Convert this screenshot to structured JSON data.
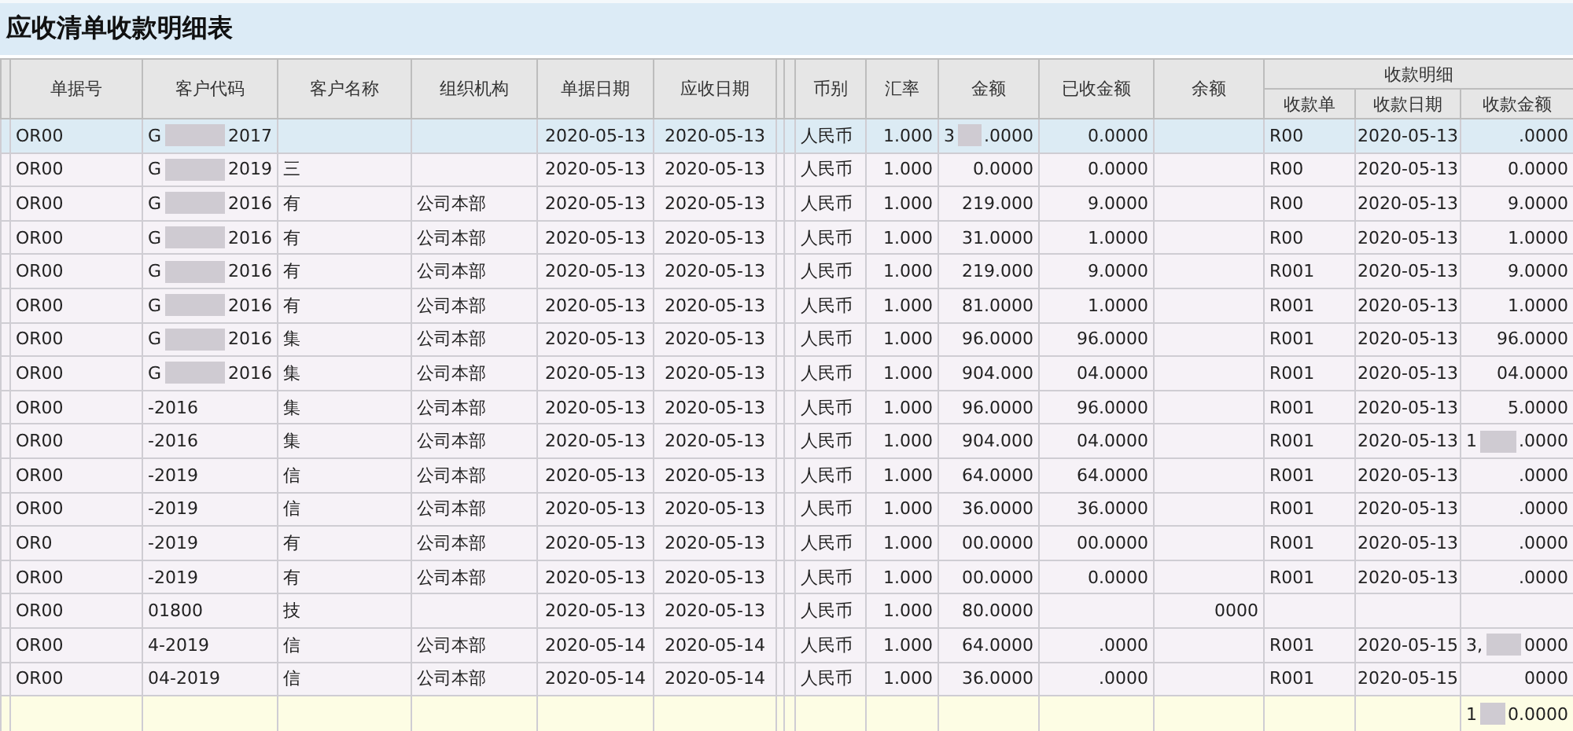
{
  "title": "应收清单收款明细表",
  "table": {
    "columns": [
      "单据号",
      "客户代码",
      "客户名称",
      "组织机构",
      "单据日期",
      "应收日期",
      "币别",
      "汇率",
      "金额",
      "已收金额",
      "余额"
    ],
    "group": {
      "label": "收款明细",
      "columns": [
        "收款单",
        "收款日期",
        "收款金额"
      ]
    },
    "rows": [
      {
        "selected": true,
        "cells": [
          [
            "OR00"
          ],
          [
            "G",
            "2017"
          ],
          [],
          [],
          [
            "2020-05-13"
          ],
          [
            "2020-05-13"
          ],
          [
            "人民币"
          ],
          [
            "1.000"
          ],
          [
            "3",
            ".0000"
          ],
          [
            "0.0000"
          ],
          [],
          [
            "R00"
          ],
          [
            "2020-05-13"
          ],
          [
            ".0000"
          ]
        ]
      },
      {
        "selected": false,
        "cells": [
          [
            "OR00"
          ],
          [
            "G",
            "2019"
          ],
          [
            "三"
          ],
          [],
          [
            "2020-05-13"
          ],
          [
            "2020-05-13"
          ],
          [
            "人民币"
          ],
          [
            "1.000"
          ],
          [
            "0.0000"
          ],
          [
            "0.0000"
          ],
          [],
          [
            "R00"
          ],
          [
            "2020-05-13"
          ],
          [
            "0.0000"
          ]
        ]
      },
      {
        "selected": false,
        "cells": [
          [
            "OR00"
          ],
          [
            "G",
            "2016"
          ],
          [
            "有"
          ],
          [
            "公司本部"
          ],
          [
            "2020-05-13"
          ],
          [
            "2020-05-13"
          ],
          [
            "人民币"
          ],
          [
            "1.000"
          ],
          [
            "219.000"
          ],
          [
            "9.0000"
          ],
          [],
          [
            "R00"
          ],
          [
            "2020-05-13"
          ],
          [
            "9.0000"
          ]
        ]
      },
      {
        "selected": false,
        "cells": [
          [
            "OR00"
          ],
          [
            "G",
            "2016"
          ],
          [
            "有"
          ],
          [
            "公司本部"
          ],
          [
            "2020-05-13"
          ],
          [
            "2020-05-13"
          ],
          [
            "人民币"
          ],
          [
            "1.000"
          ],
          [
            "31.0000"
          ],
          [
            "1.0000"
          ],
          [],
          [
            "R00"
          ],
          [
            "2020-05-13"
          ],
          [
            "1.0000"
          ]
        ]
      },
      {
        "selected": false,
        "cells": [
          [
            "OR00"
          ],
          [
            "G",
            "2016"
          ],
          [
            "有"
          ],
          [
            "公司本部"
          ],
          [
            "2020-05-13"
          ],
          [
            "2020-05-13"
          ],
          [
            "人民币"
          ],
          [
            "1.000"
          ],
          [
            "219.000"
          ],
          [
            "9.0000"
          ],
          [],
          [
            "R001"
          ],
          [
            "2020-05-13"
          ],
          [
            "9.0000"
          ]
        ]
      },
      {
        "selected": false,
        "cells": [
          [
            "OR00"
          ],
          [
            "G",
            "2016"
          ],
          [
            "有"
          ],
          [
            "公司本部"
          ],
          [
            "2020-05-13"
          ],
          [
            "2020-05-13"
          ],
          [
            "人民币"
          ],
          [
            "1.000"
          ],
          [
            "81.0000"
          ],
          [
            "1.0000"
          ],
          [],
          [
            "R001"
          ],
          [
            "2020-05-13"
          ],
          [
            "1.0000"
          ]
        ]
      },
      {
        "selected": false,
        "cells": [
          [
            "OR00"
          ],
          [
            "G",
            "2016"
          ],
          [
            "集"
          ],
          [
            "公司本部"
          ],
          [
            "2020-05-13"
          ],
          [
            "2020-05-13"
          ],
          [
            "人民币"
          ],
          [
            "1.000"
          ],
          [
            "96.0000"
          ],
          [
            "96.0000"
          ],
          [],
          [
            "R001"
          ],
          [
            "2020-05-13"
          ],
          [
            "96.0000"
          ]
        ]
      },
      {
        "selected": false,
        "cells": [
          [
            "OR00"
          ],
          [
            "G",
            "2016"
          ],
          [
            "集"
          ],
          [
            "公司本部"
          ],
          [
            "2020-05-13"
          ],
          [
            "2020-05-13"
          ],
          [
            "人民币"
          ],
          [
            "1.000"
          ],
          [
            "904.000"
          ],
          [
            "04.0000"
          ],
          [],
          [
            "R001"
          ],
          [
            "2020-05-13"
          ],
          [
            "04.0000"
          ]
        ]
      },
      {
        "selected": false,
        "cells": [
          [
            "OR00"
          ],
          [
            "-2016"
          ],
          [
            "集"
          ],
          [
            "公司本部"
          ],
          [
            "2020-05-13"
          ],
          [
            "2020-05-13"
          ],
          [
            "人民币"
          ],
          [
            "1.000"
          ],
          [
            "96.0000"
          ],
          [
            "96.0000"
          ],
          [],
          [
            "R001"
          ],
          [
            "2020-05-13"
          ],
          [
            "5.0000"
          ]
        ]
      },
      {
        "selected": false,
        "cells": [
          [
            "OR00"
          ],
          [
            "-2016"
          ],
          [
            "集"
          ],
          [
            "公司本部"
          ],
          [
            "2020-05-13"
          ],
          [
            "2020-05-13"
          ],
          [
            "人民币"
          ],
          [
            "1.000"
          ],
          [
            "904.000"
          ],
          [
            "04.0000"
          ],
          [],
          [
            "R001"
          ],
          [
            "2020-05-13"
          ],
          [
            "1",
            ".0000"
          ]
        ]
      },
      {
        "selected": false,
        "cells": [
          [
            "OR00"
          ],
          [
            "-2019"
          ],
          [
            "信"
          ],
          [
            "公司本部"
          ],
          [
            "2020-05-13"
          ],
          [
            "2020-05-13"
          ],
          [
            "人民币"
          ],
          [
            "1.000"
          ],
          [
            "64.0000"
          ],
          [
            "64.0000"
          ],
          [],
          [
            "R001"
          ],
          [
            "2020-05-13"
          ],
          [
            ".0000"
          ]
        ]
      },
      {
        "selected": false,
        "cells": [
          [
            "OR00"
          ],
          [
            "-2019"
          ],
          [
            "信"
          ],
          [
            "公司本部"
          ],
          [
            "2020-05-13"
          ],
          [
            "2020-05-13"
          ],
          [
            "人民币"
          ],
          [
            "1.000"
          ],
          [
            "36.0000"
          ],
          [
            "36.0000"
          ],
          [],
          [
            "R001"
          ],
          [
            "2020-05-13"
          ],
          [
            ".0000"
          ]
        ]
      },
      {
        "selected": false,
        "cells": [
          [
            "OR0"
          ],
          [
            "-2019"
          ],
          [
            "有"
          ],
          [
            "公司本部"
          ],
          [
            "2020-05-13"
          ],
          [
            "2020-05-13"
          ],
          [
            "人民币"
          ],
          [
            "1.000"
          ],
          [
            "00.0000"
          ],
          [
            "00.0000"
          ],
          [],
          [
            "R001"
          ],
          [
            "2020-05-13"
          ],
          [
            ".0000"
          ]
        ]
      },
      {
        "selected": false,
        "cells": [
          [
            "OR00"
          ],
          [
            "-2019"
          ],
          [
            "有"
          ],
          [
            "公司本部"
          ],
          [
            "2020-05-13"
          ],
          [
            "2020-05-13"
          ],
          [
            "人民币"
          ],
          [
            "1.000"
          ],
          [
            "00.0000"
          ],
          [
            "0.0000"
          ],
          [],
          [
            "R001"
          ],
          [
            "2020-05-13"
          ],
          [
            ".0000"
          ]
        ]
      },
      {
        "selected": false,
        "cells": [
          [
            "OR00"
          ],
          [
            "01800"
          ],
          [
            "技"
          ],
          [],
          [
            "2020-05-13"
          ],
          [
            "2020-05-13"
          ],
          [
            "人民币"
          ],
          [
            "1.000"
          ],
          [
            "80.0000"
          ],
          [],
          [
            "0000"
          ],
          [],
          [],
          []
        ]
      },
      {
        "selected": false,
        "cells": [
          [
            "OR00"
          ],
          [
            "4-2019"
          ],
          [
            "信"
          ],
          [
            "公司本部"
          ],
          [
            "2020-05-14"
          ],
          [
            "2020-05-14"
          ],
          [
            "人民币"
          ],
          [
            "1.000"
          ],
          [
            "64.0000"
          ],
          [
            ".0000"
          ],
          [],
          [
            "R001"
          ],
          [
            "2020-05-15"
          ],
          [
            "3,",
            "0000"
          ]
        ]
      },
      {
        "selected": false,
        "cells": [
          [
            "OR00"
          ],
          [
            "04-2019"
          ],
          [
            "信"
          ],
          [
            "公司本部"
          ],
          [
            "2020-05-14"
          ],
          [
            "2020-05-14"
          ],
          [
            "人民币"
          ],
          [
            "1.000"
          ],
          [
            "36.0000"
          ],
          [
            ".0000"
          ],
          [],
          [
            "R001"
          ],
          [
            "2020-05-15"
          ],
          [
            "0000"
          ]
        ]
      }
    ],
    "total_row": {
      "cells": [
        [],
        [],
        [],
        [],
        [],
        [],
        [],
        [],
        [],
        [],
        [],
        [],
        [],
        [
          "1",
          "0.0000"
        ]
      ]
    }
  }
}
